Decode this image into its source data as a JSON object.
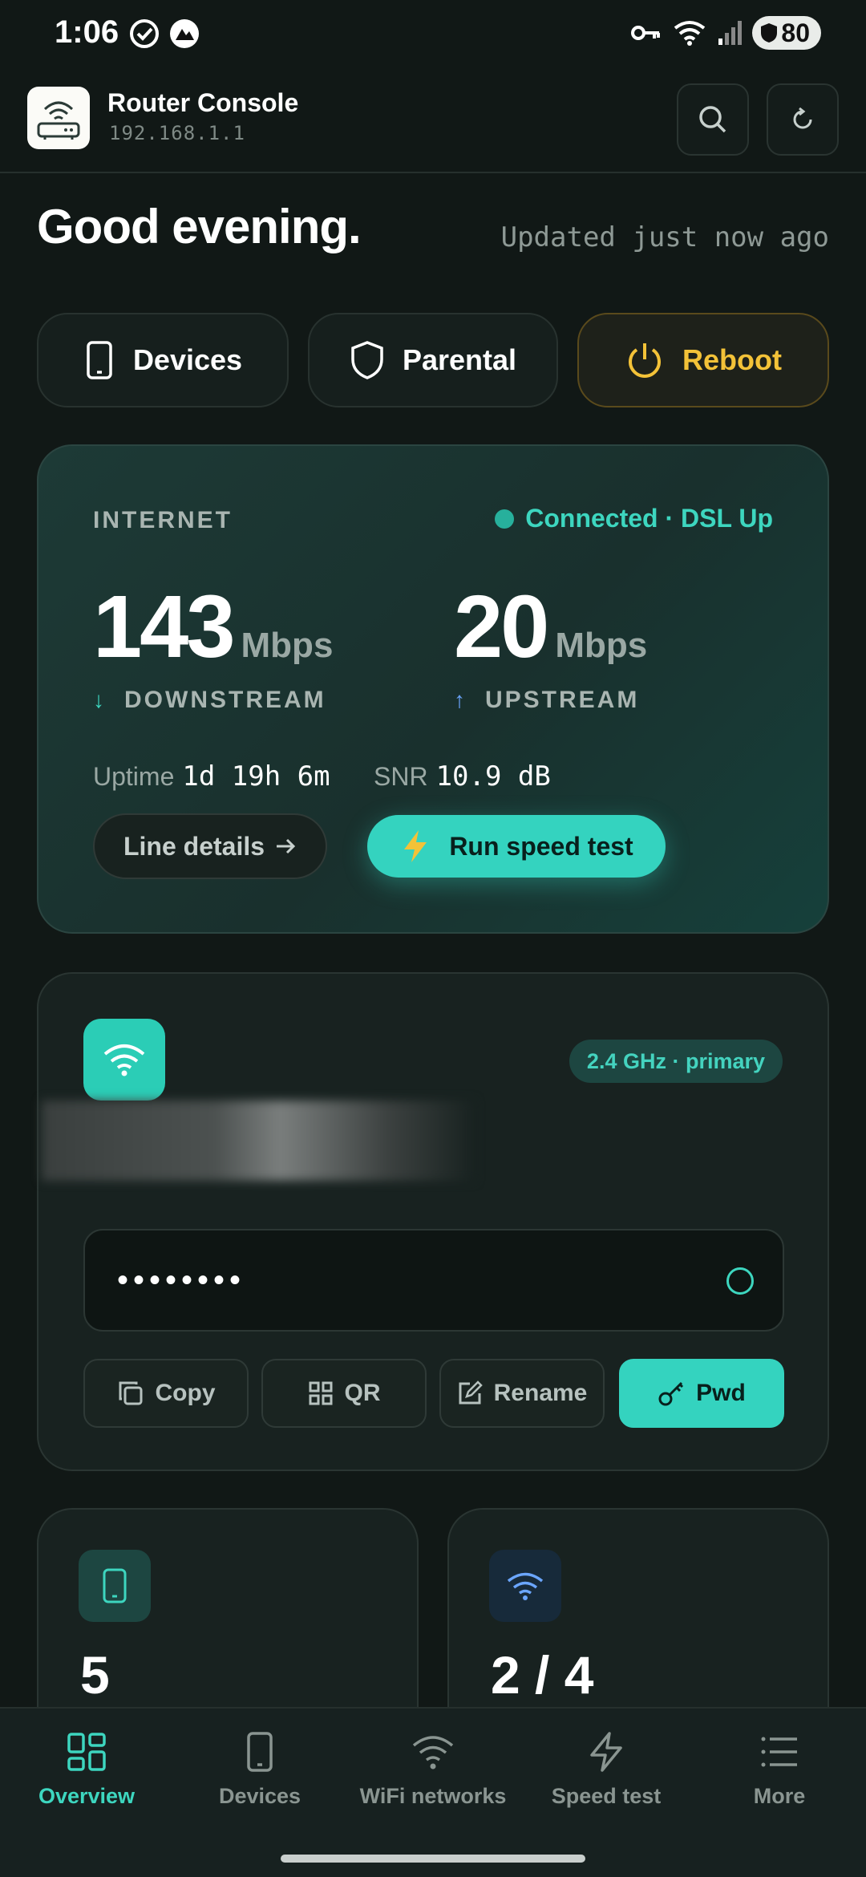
{
  "status_bar": {
    "time": "1:06",
    "battery": "80"
  },
  "header": {
    "title": "Router Console",
    "subtitle": "192.168.1.1"
  },
  "greeting": {
    "text": "Good evening.",
    "updated": "Updated just now ago"
  },
  "quick_actions": [
    {
      "label": "Devices",
      "icon": "phone-icon"
    },
    {
      "label": "Parental",
      "icon": "shield-icon"
    },
    {
      "label": "Reboot",
      "icon": "power-icon"
    }
  ],
  "internet": {
    "label": "INTERNET",
    "status": "Connected · DSL Up",
    "down_value": "143",
    "down_unit": "Mbps",
    "down_label": "DOWNSTREAM",
    "up_value": "20",
    "up_unit": "Mbps",
    "up_label": "UPSTREAM",
    "uptime_label": "Uptime",
    "uptime_value": "1d 19h 6m",
    "snr_label": "SNR",
    "snr_value": "10.9 dB",
    "line_details": "Line details",
    "run_speed_test": "Run speed test"
  },
  "wifi": {
    "band": "2.4 GHz · primary",
    "password_masked": "••••••••",
    "buttons": [
      "Copy",
      "QR",
      "Rename",
      "Pwd"
    ]
  },
  "stats": [
    {
      "value": "5",
      "icon": "device-icon"
    },
    {
      "value": "2 / 4",
      "icon": "wifi-icon"
    }
  ],
  "nav": [
    {
      "label": "Overview",
      "icon": "grid-icon"
    },
    {
      "label": "Devices",
      "icon": "phone-icon"
    },
    {
      "label": "WiFi networks",
      "icon": "wifi-icon"
    },
    {
      "label": "Speed test",
      "icon": "bolt-icon"
    },
    {
      "label": "More",
      "icon": "list-icon"
    }
  ],
  "colors": {
    "accent": "#34d3bf",
    "warning": "#f3c238",
    "background": "#111816"
  }
}
